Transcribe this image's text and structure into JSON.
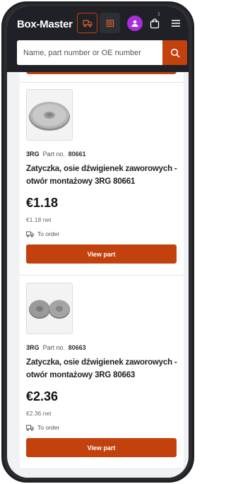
{
  "header": {
    "logo": "Box-Master",
    "cart_count": "1"
  },
  "search": {
    "placeholder": "Name, part number or OE number"
  },
  "colors": {
    "accent": "#c2410c",
    "header_bg": "#202126",
    "avatar": "#a62fd8"
  },
  "products": [
    {
      "brand": "3RG",
      "part_no_label": "Part no.",
      "part_no": "80661",
      "title": "Zatyczka, osie dźwigienek zaworowych - otwór montażowy 3RG 80661",
      "price": "€1.18",
      "net": "€1.18 net",
      "availability": "To order",
      "button": "View part",
      "image_icon": "single-plug-image"
    },
    {
      "brand": "3RG",
      "part_no_label": "Part no.",
      "part_no": "80663",
      "title": "Zatyczka, osie dźwigienek zaworowych - otwór montażowy 3RG 80663",
      "price": "€2.36",
      "net": "€2.36 net",
      "availability": "To order",
      "button": "View part",
      "image_icon": "double-plug-image"
    }
  ]
}
